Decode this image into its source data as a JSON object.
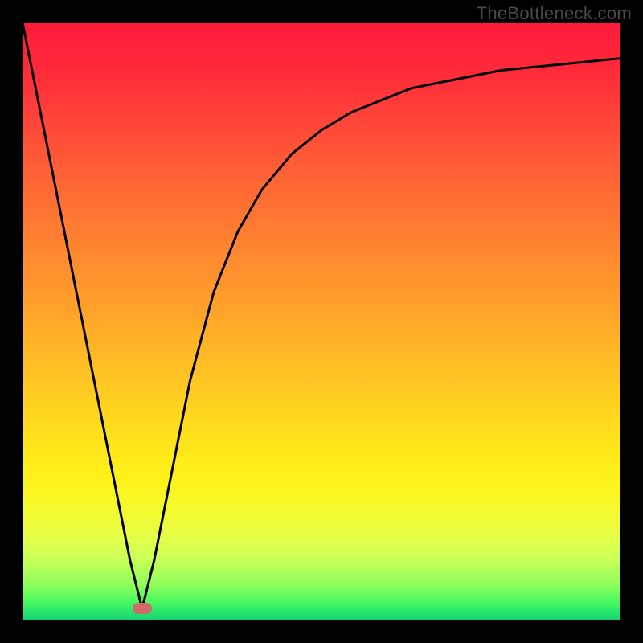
{
  "watermark": "TheBottleneck.com",
  "colors": {
    "frame_bg": "#000000",
    "curve": "#000000",
    "marker": "#cf6a6a",
    "watermark_text": "#4a4a4a"
  },
  "chart_data": {
    "type": "line",
    "title": "",
    "xlabel": "",
    "ylabel": "",
    "xlim": [
      0,
      100
    ],
    "ylim": [
      0,
      100
    ],
    "grid": false,
    "background_gradient": {
      "direction": "top-to-bottom",
      "stops": [
        {
          "pos": 0,
          "color": "#ff1a3a"
        },
        {
          "pos": 50,
          "color": "#ffa22a"
        },
        {
          "pos": 78,
          "color": "#fff018"
        },
        {
          "pos": 100,
          "color": "#20e070"
        }
      ]
    },
    "series": [
      {
        "name": "bottleneck-curve",
        "x": [
          0,
          5,
          10,
          15,
          18,
          20,
          22,
          25,
          28,
          32,
          36,
          40,
          45,
          50,
          55,
          60,
          65,
          70,
          75,
          80,
          85,
          90,
          95,
          100
        ],
        "y": [
          100,
          75,
          50,
          25,
          10,
          2,
          10,
          25,
          40,
          55,
          65,
          72,
          78,
          82,
          85,
          87,
          89,
          90,
          91,
          92,
          92.5,
          93,
          93.5,
          94
        ]
      }
    ],
    "marker": {
      "x": 20,
      "y": 2,
      "shape": "pill",
      "color": "#cf6a6a"
    }
  }
}
